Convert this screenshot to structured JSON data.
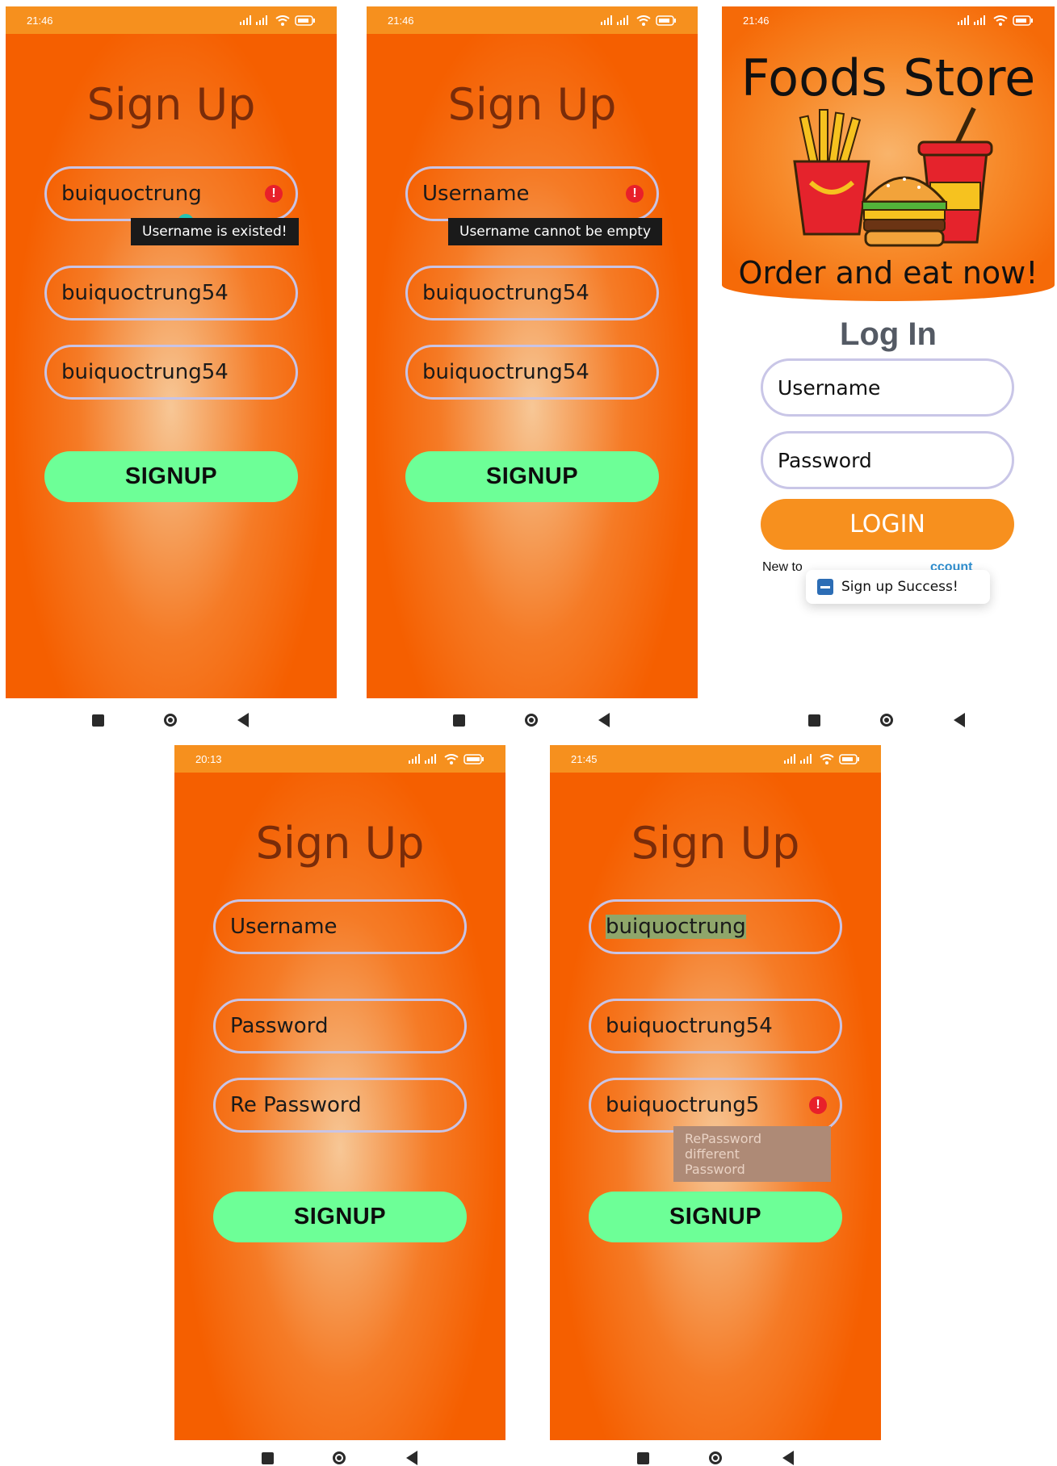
{
  "screens": {
    "s1": {
      "status_time": "21:46",
      "title": "Sign Up",
      "username_value": "buiquoctrung",
      "password_value": "buiquoctrung54",
      "repassword_value": "buiquoctrung54",
      "error_tooltip": "Username is existed!",
      "signup_label": "SIGNUP"
    },
    "s2": {
      "status_time": "21:46",
      "title": "Sign Up",
      "username_placeholder": "Username",
      "password_value": "buiquoctrung54",
      "repassword_value": "buiquoctrung54",
      "error_tooltip": "Username cannot be empty",
      "signup_label": "SIGNUP"
    },
    "s3": {
      "status_time": "21:46",
      "store_title": "Foods Store",
      "tagline": "Order and eat now!",
      "heading": "Log In",
      "username_placeholder": "Username",
      "password_placeholder": "Password",
      "login_label": "LOGIN",
      "footer_prefix": "New to ",
      "footer_link": "ccount",
      "toast_text": "Sign up Success!"
    },
    "s4": {
      "status_time": "20:13",
      "title": "Sign Up",
      "username_placeholder": "Username",
      "password_placeholder": "Password",
      "repassword_placeholder": "Re Password",
      "signup_label": "SIGNUP"
    },
    "s5": {
      "status_time": "21:45",
      "title": "Sign Up",
      "username_value": "buiquoctrung",
      "password_value": "buiquoctrung54",
      "repassword_value": "buiquoctrung5",
      "error_tooltip_line1": "RePassword different",
      "error_tooltip_line2": "Password",
      "signup_label": "SIGNUP"
    }
  },
  "colors": {
    "statusbar": "#f6901e",
    "title_text": "#7a2c09",
    "signup_button": "#6dff97",
    "login_button": "#f7901e",
    "error": "#e8202a",
    "link": "#2f8fd0"
  },
  "icons": [
    "alarm-icon",
    "signal-icon",
    "wifi-icon",
    "battery-icon",
    "error-icon",
    "nav-recents-icon",
    "nav-home-icon",
    "nav-back-icon",
    "fries-icon",
    "burger-icon",
    "soda-icon",
    "app-icon"
  ]
}
